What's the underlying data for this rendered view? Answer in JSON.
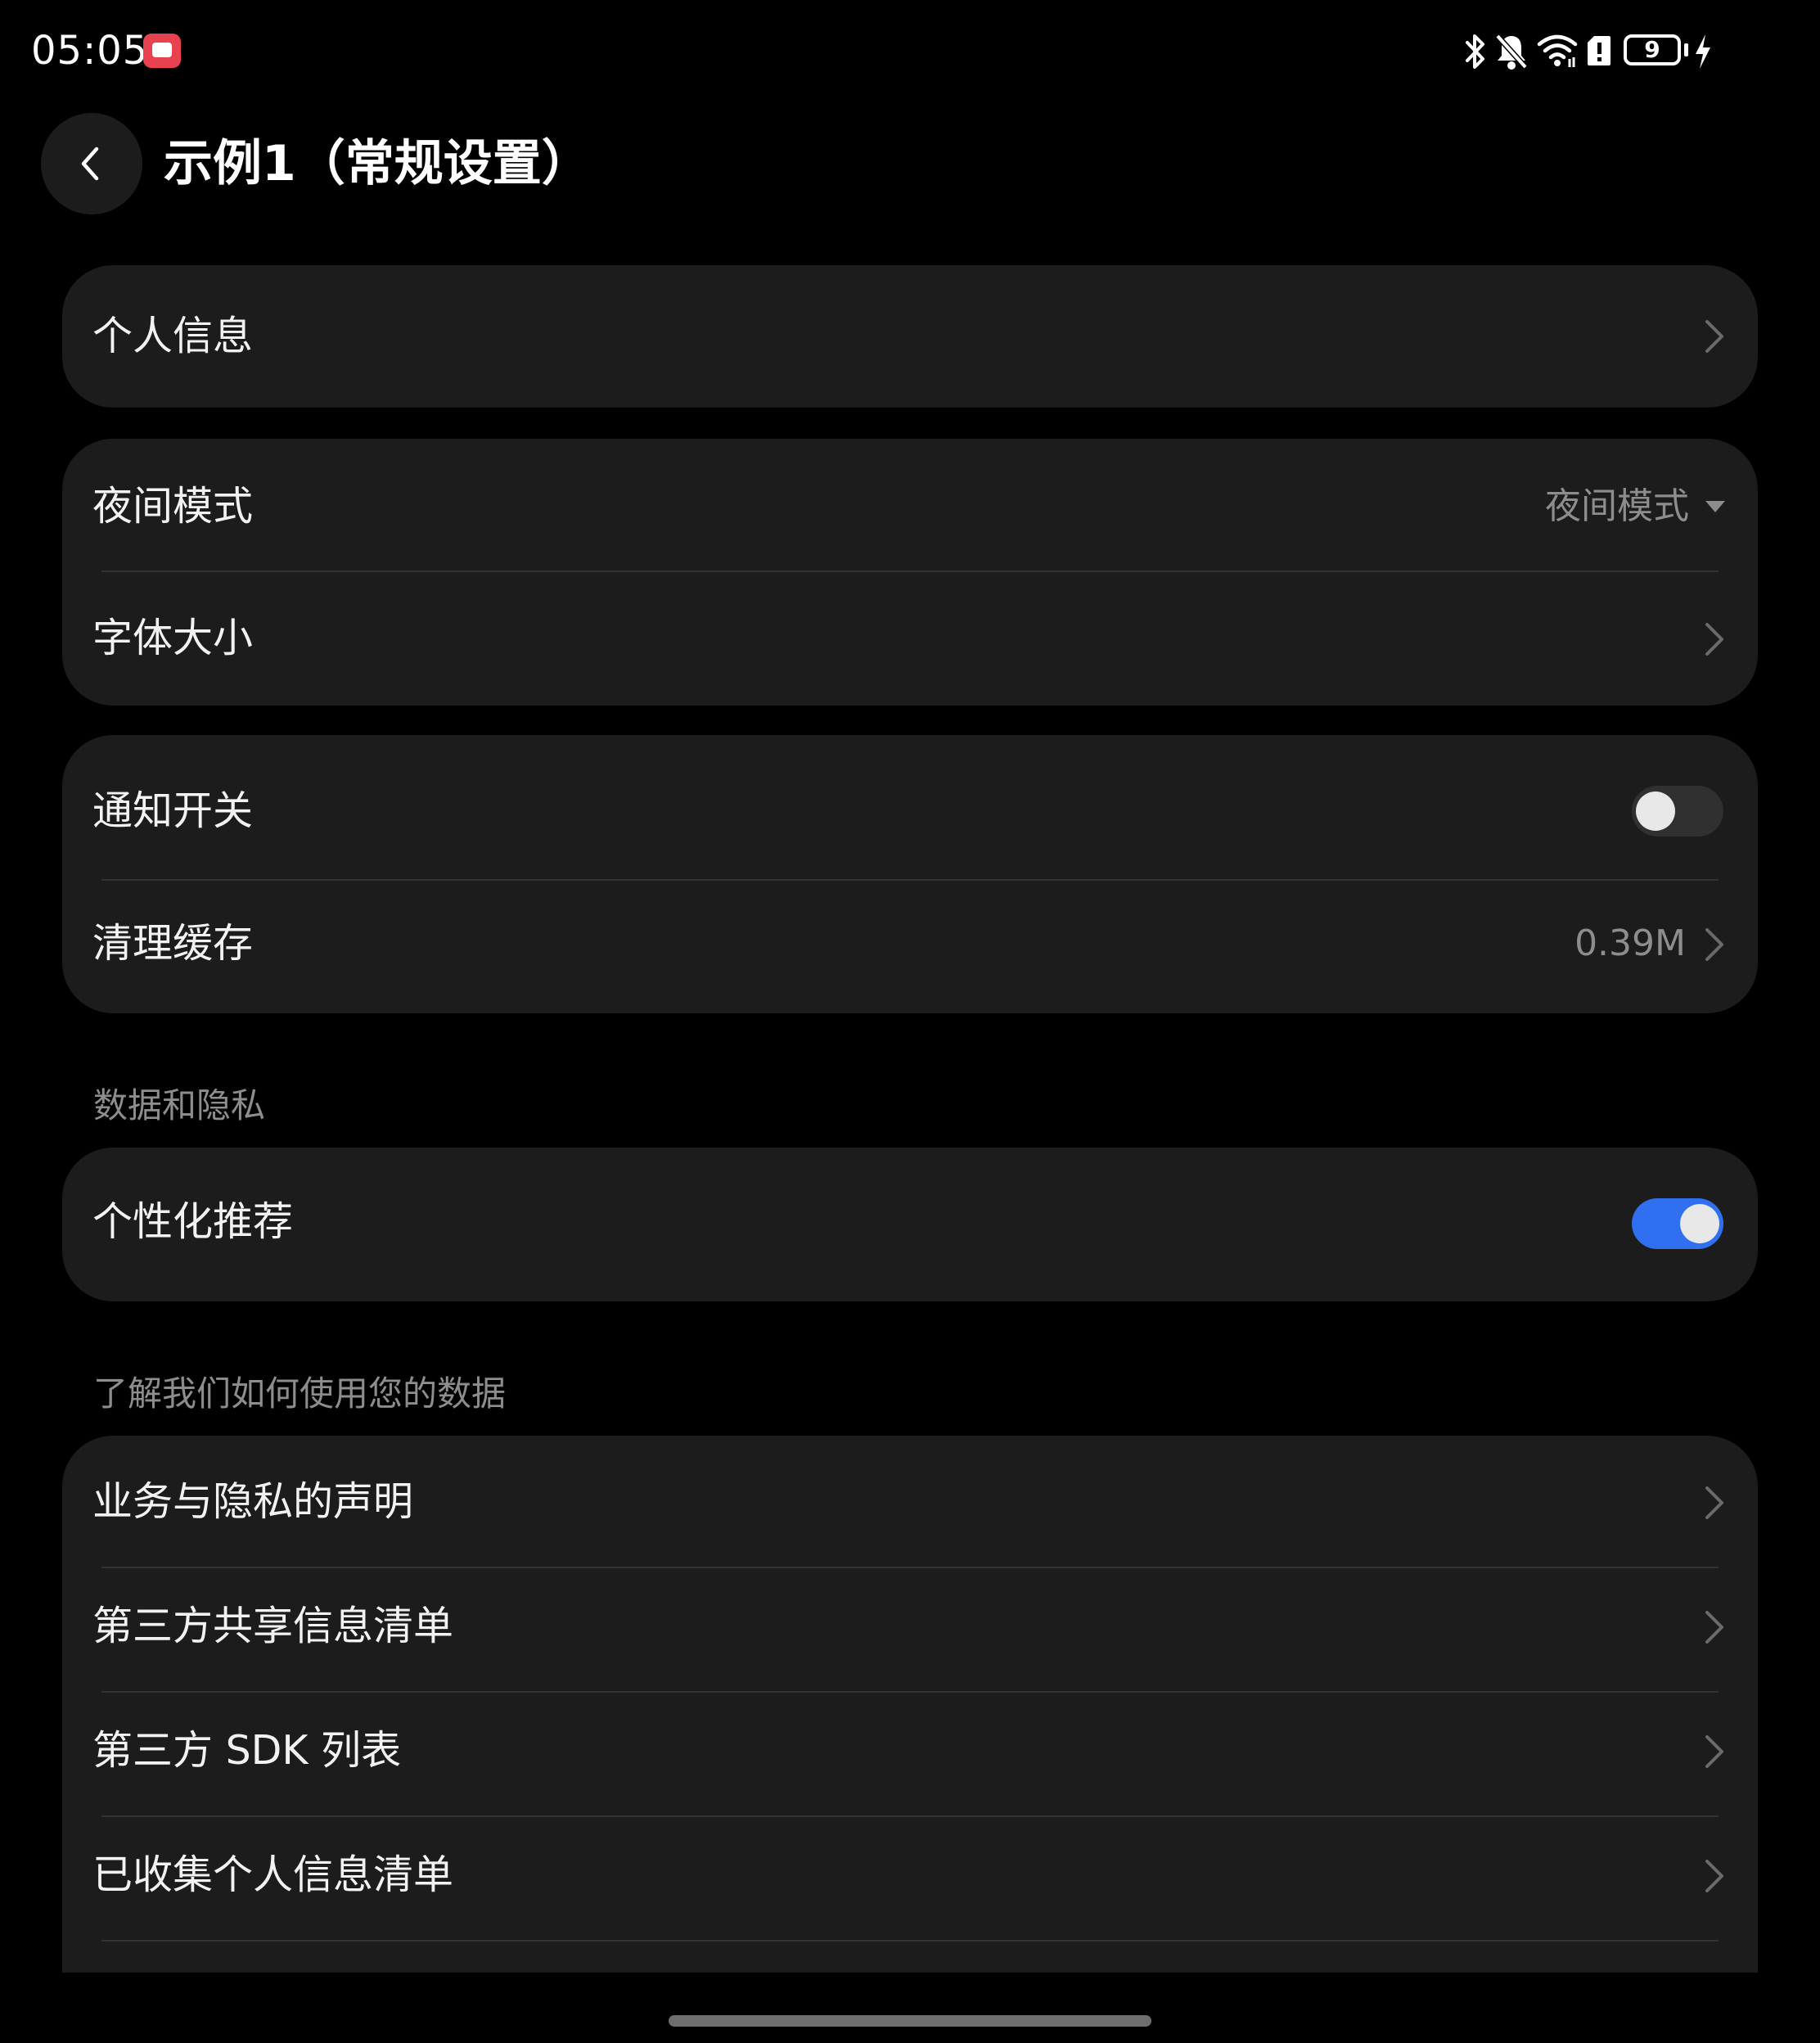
{
  "status_bar": {
    "time": "05:05",
    "battery_level": "9",
    "icons": [
      "bluetooth-icon",
      "bell-muted-icon",
      "wifi-icon",
      "sim-alert-icon",
      "battery-icon",
      "charging-icon"
    ]
  },
  "header": {
    "back_icon": "chevron-left-icon",
    "title": "示例1（常规设置）"
  },
  "group1": {
    "personal_info": "个人信息"
  },
  "group2": {
    "night_mode_label": "夜间模式",
    "night_mode_value": "夜间模式",
    "font_size_label": "字体大小"
  },
  "group3": {
    "notification_label": "通知开关",
    "notification_on": false,
    "clear_cache_label": "清理缓存",
    "clear_cache_value": "0.39M"
  },
  "section_data_privacy": {
    "header": "数据和隐私",
    "personalized_label": "个性化推荐",
    "personalized_on": true
  },
  "section_data_usage": {
    "header": "了解我们如何使用您的数据",
    "items": [
      "业务与隐私的声明",
      "第三方共享信息清单",
      "第三方 SDK 列表",
      "已收集个人信息清单"
    ]
  },
  "colors": {
    "background": "#000000",
    "card": "#1c1c1c",
    "accent": "#2f6ff0",
    "secondary_text": "#8d8d8d"
  }
}
